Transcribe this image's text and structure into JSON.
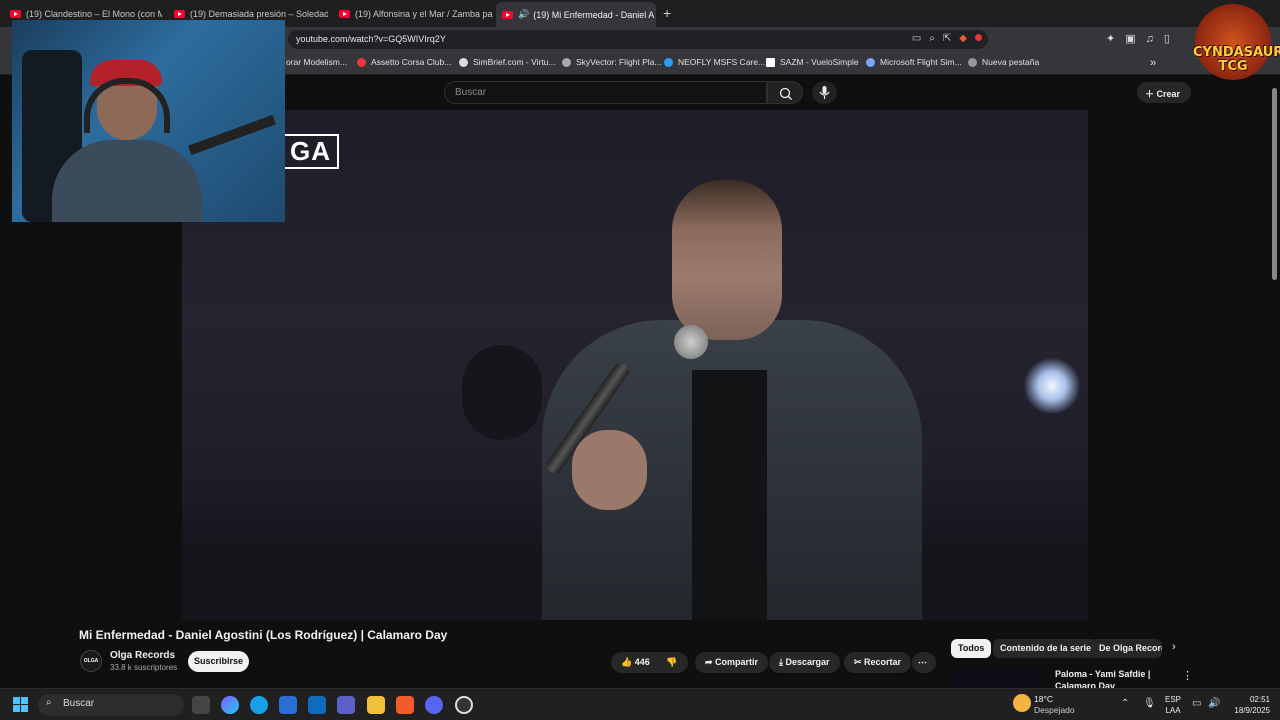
{
  "browser": {
    "tabs": [
      {
        "label": "(19) Clandestino – El Mono (con Mex"
      },
      {
        "label": "(19) Demasiada presión – Soledad (c"
      },
      {
        "label": "(19) Alfonsina y el Mar / Zamba para"
      },
      {
        "label": "(19) Mi Enfermedad - Daniel A"
      }
    ],
    "new_tab": "+",
    "url": "youtube.com/watch?v=GQ5WIVIrq2Y",
    "bookmarks": [
      {
        "label": "orar Modelism..."
      },
      {
        "label": "Assetto Corsa Club..."
      },
      {
        "label": "SimBrief.com - Virtu..."
      },
      {
        "label": "SkyVector: Flight Pla..."
      },
      {
        "label": "NEOFLY MSFS Care..."
      },
      {
        "label": "SAZM - VueloSimple"
      },
      {
        "label": "Microsoft Flight Sim..."
      },
      {
        "label": "Nueva pestaña"
      }
    ]
  },
  "youtube": {
    "search_placeholder": "Buscar",
    "create_label": "Crear",
    "video": {
      "watermark": "GA",
      "title": "Mi Enfermedad - Daniel Agostini (Los Rodríguez) | Calamaro Day",
      "channel": "Olga Records",
      "channel_avatar": "OLGA",
      "subscribers": "33.8 k suscriptores",
      "subscribe_label": "Suscribirse",
      "likes": "446",
      "share_label": "Compartir",
      "download_label": "Descargar",
      "clip_label": "Recortar"
    },
    "chips": [
      {
        "label": "Todos",
        "selected": true
      },
      {
        "label": "Contenido de la serie"
      },
      {
        "label": "De Olga Records"
      }
    ],
    "recommendation": {
      "title": "Paloma - Yami Safdie | Calamaro Day"
    }
  },
  "overlay": {
    "logo_text": "CYNDASAUR TCG"
  },
  "taskbar": {
    "search_label": "Buscar",
    "weather_temp": "18°C",
    "weather_desc": "Despejado",
    "lang_1": "ESP",
    "lang_2": "LAA",
    "time": "02:51",
    "date": "18/9/2025"
  },
  "colors": {
    "youtube_red": "#ff0033",
    "accent_blue": "#4cc2ff"
  }
}
